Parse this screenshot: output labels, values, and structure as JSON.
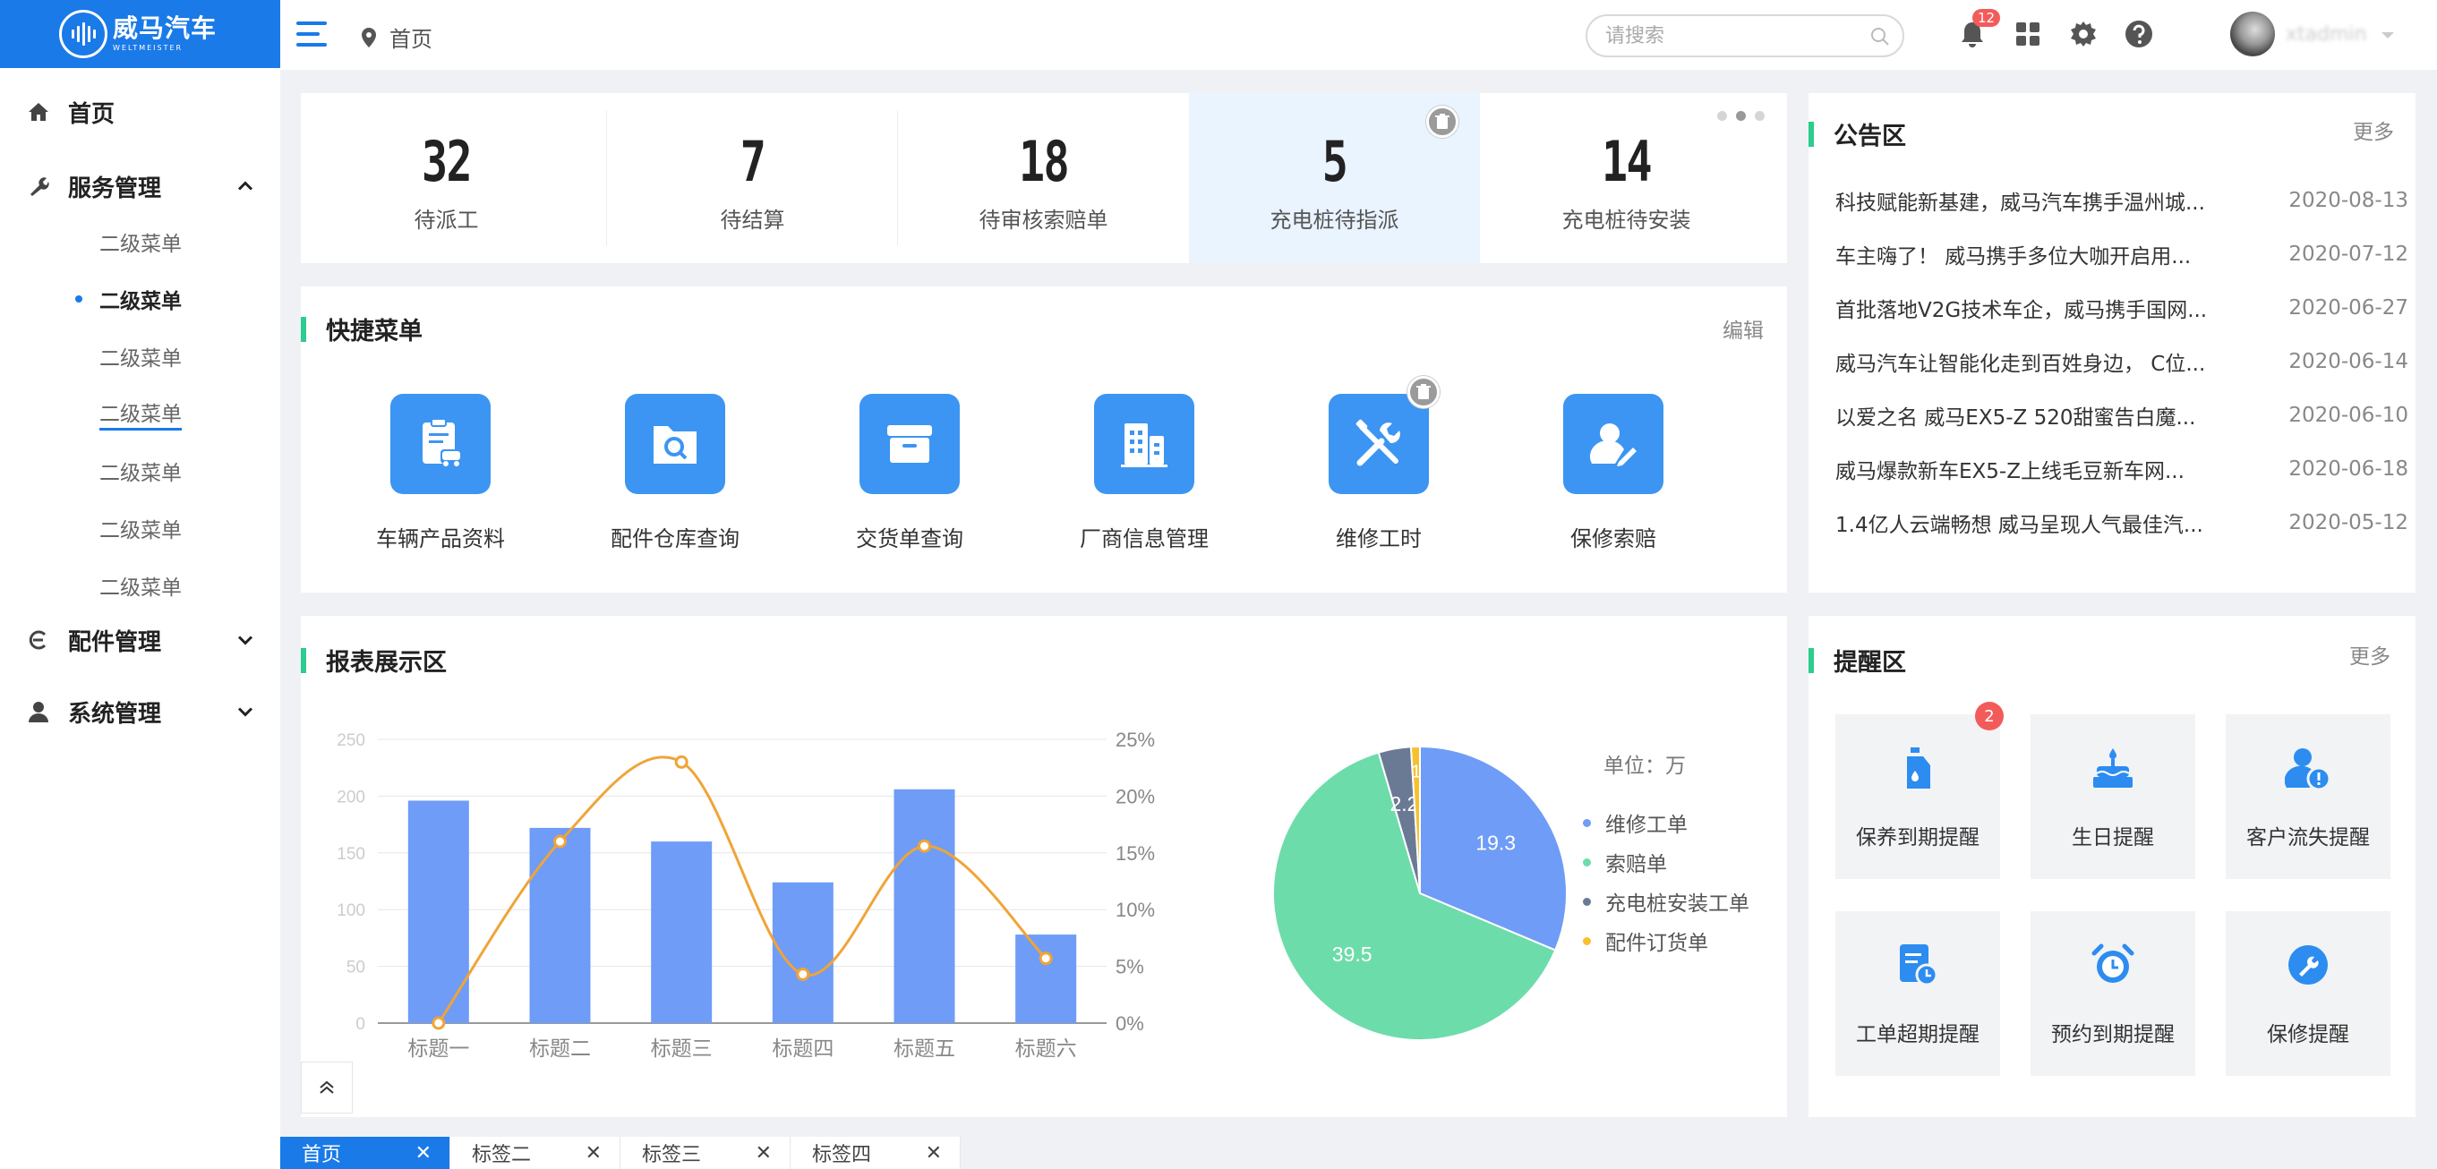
{
  "brand": {
    "name_cn": "威马汽车",
    "name_en": "WELTMEISTER"
  },
  "sidebar": {
    "home": "首页",
    "service": "服务管理",
    "sub_items": [
      "二级菜单",
      "二级菜单",
      "二级菜单",
      "二级菜单",
      "二级菜单",
      "二级菜单",
      "二级菜单"
    ],
    "parts": "配件管理",
    "system": "系统管理"
  },
  "topbar": {
    "breadcrumb": "首页",
    "search_placeholder": "请搜索",
    "notification_count": "12",
    "username": "xtadmin"
  },
  "stats": [
    {
      "value": "32",
      "label": "待派工"
    },
    {
      "value": "7",
      "label": "待结算"
    },
    {
      "value": "18",
      "label": "待审核索赔单"
    },
    {
      "value": "5",
      "label": "充电桩待指派"
    },
    {
      "value": "14",
      "label": "充电桩待安装"
    }
  ],
  "quick_menu": {
    "title": "快捷菜单",
    "edit": "编辑",
    "items": [
      {
        "label": "车辆产品资料",
        "icon": "vehicle-document-icon"
      },
      {
        "label": "配件仓库查询",
        "icon": "folder-search-icon"
      },
      {
        "label": "交货单查询",
        "icon": "box-icon"
      },
      {
        "label": "厂商信息管理",
        "icon": "building-icon"
      },
      {
        "label": "维修工时",
        "icon": "tools-icon"
      },
      {
        "label": "保修索赔",
        "icon": "user-edit-icon"
      }
    ]
  },
  "notices": {
    "title": "公告区",
    "more": "更多",
    "items": [
      {
        "title": "科技赋能新基建，威马汽车携手温州城...",
        "date": "2020-08-13"
      },
      {
        "title": "车主嗨了！ 威马携手多位大咖开启用...",
        "date": "2020-07-12"
      },
      {
        "title": "首批落地V2G技术车企，威马携手国网...",
        "date": "2020-06-27"
      },
      {
        "title": "威马汽车让智能化走到百姓身边， C位...",
        "date": "2020-06-14"
      },
      {
        "title": "以爱之名 威马EX5-Z 520甜蜜告白魔...",
        "date": "2020-06-10"
      },
      {
        "title": "威马爆款新车EX5-Z上线毛豆新车网...",
        "date": "2020-06-18"
      },
      {
        "title": "1.4亿人云端畅想 威马呈现人气最佳汽...",
        "date": "2020-05-12"
      }
    ]
  },
  "report": {
    "title": "报表展示区",
    "unit": "单位：万"
  },
  "reminders": {
    "title": "提醒区",
    "more": "更多",
    "badge": "2",
    "items": [
      {
        "label": "保养到期提醒",
        "icon": "oil-bottle-icon"
      },
      {
        "label": "生日提醒",
        "icon": "cake-icon"
      },
      {
        "label": "客户流失提醒",
        "icon": "user-alert-icon"
      },
      {
        "label": "工单超期提醒",
        "icon": "doc-clock-icon"
      },
      {
        "label": "预约到期提醒",
        "icon": "alarm-clock-icon"
      },
      {
        "label": "保修提醒",
        "icon": "wrench-circle-icon"
      }
    ]
  },
  "tabs": [
    {
      "label": "首页",
      "active": true
    },
    {
      "label": "标签二",
      "active": false
    },
    {
      "label": "标签三",
      "active": false
    },
    {
      "label": "标签四",
      "active": false
    }
  ],
  "colors": {
    "primary": "#1a7ae8",
    "bar": "#6f9cf6",
    "line": "#f0a437",
    "accent": "#2dcc8f",
    "badge": "#f35b5b"
  },
  "chart_data": [
    {
      "type": "bar",
      "categories": [
        "标题一",
        "标题二",
        "标题三",
        "标题四",
        "标题五",
        "标题六"
      ],
      "series": [
        {
          "type": "bar",
          "values": [
            196,
            172,
            160,
            124,
            206,
            78
          ]
        },
        {
          "type": "line",
          "values": [
            0,
            16,
            23,
            4.3,
            15.6,
            5.7
          ]
        }
      ],
      "y_ticks_left": [
        "0",
        "50",
        "100",
        "150",
        "200",
        "250"
      ],
      "y_ticks_right": [
        "0%",
        "5%",
        "10%",
        "15%",
        "20%",
        "25%"
      ],
      "ylim_left": [
        0,
        250
      ],
      "ylim_right": [
        0,
        25
      ]
    },
    {
      "type": "pie",
      "unit": "单位：万",
      "slices": [
        {
          "name": "维修工单",
          "value": 19.3,
          "label": "19.3",
          "color": "#6f9cf6"
        },
        {
          "name": "索赔单",
          "value": 39.5,
          "label": "39.5",
          "color": "#6ddcab"
        },
        {
          "name": "充电桩安装工单",
          "value": 2.2,
          "label": "2.2",
          "color": "#6b7a94"
        },
        {
          "name": "配件订货单",
          "value": 0.6,
          "label": "1",
          "color": "#f6c12c"
        }
      ]
    }
  ]
}
